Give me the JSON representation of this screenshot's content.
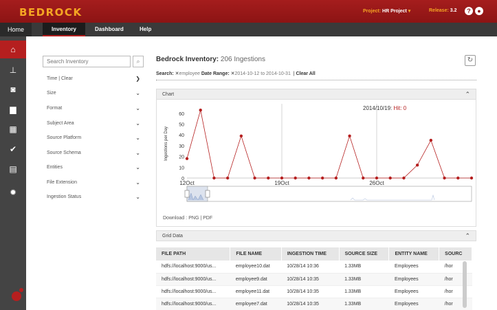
{
  "header": {
    "logo": "BEDROCK",
    "project_label": "Project:",
    "project_value": "HR Project",
    "release_label": "Release:",
    "release_value": "3.2",
    "help_icon": "?",
    "user_icon": "user-icon"
  },
  "nav": {
    "home": "Home",
    "tabs": [
      {
        "label": "Inventory"
      },
      {
        "label": "Dashboard"
      },
      {
        "label": "Help"
      }
    ]
  },
  "rail": {
    "icons": [
      "home-icon",
      "lineage-icon",
      "inventory-icon",
      "briefcase-icon",
      "grid-icon",
      "check-icon",
      "clipboard-icon",
      "settings-icon"
    ]
  },
  "filters": {
    "search_placeholder": "Search Inventory",
    "time_label": "Time | Clear",
    "facets": [
      {
        "label": "Size"
      },
      {
        "label": "Format"
      },
      {
        "label": "Subject Area"
      },
      {
        "label": "Source Platform"
      },
      {
        "label": "Source Schema"
      },
      {
        "label": "Entities"
      },
      {
        "label": "File Extension"
      },
      {
        "label": "Ingestion Status"
      }
    ]
  },
  "main": {
    "title": "Bedrock Inventory:",
    "count": "206 Ingestions",
    "search_label": "Search:",
    "search_term": "employee",
    "date_range_label": "Date Range:",
    "date_range_value": "2014-10-12 to 2014-10-31",
    "clear_all": "Clear All",
    "chart_panel": "Chart",
    "grid_panel": "Grid Data",
    "download_label": "Download :",
    "download_links": "PNG | PDF"
  },
  "chart_data": {
    "type": "line",
    "ylabel": "Ingestions per Day",
    "ylim": [
      0,
      65
    ],
    "yticks": [
      0,
      10,
      20,
      30,
      40,
      50,
      60
    ],
    "xtick_labels": [
      "12Oct",
      "19Oct",
      "26Oct"
    ],
    "tooltip": "2014/10/19:",
    "tooltip_hit": "Hit: 0",
    "series_color": "#b51f1f",
    "values": [
      18,
      63,
      0,
      0,
      39,
      0,
      0,
      0,
      0,
      0,
      0,
      0,
      39,
      0,
      0,
      0,
      0,
      12,
      35,
      0,
      0,
      0
    ]
  },
  "grid": {
    "columns": [
      "FILE PATH",
      "FILE NAME",
      "INGESTION TIME",
      "SOURCE SIZE",
      "ENTITY NAME",
      "SOURC"
    ],
    "rows": [
      [
        "hdfs://localhost:9000/us...",
        "employee10.dat",
        "10/28/14 10:36",
        "1.33MB",
        "Employees",
        "/hor"
      ],
      [
        "hdfs://localhost:9000/us...",
        "employee9.dat",
        "10/28/14 10:35",
        "1.33MB",
        "Employees",
        "/hor"
      ],
      [
        "hdfs://localhost:9000/us...",
        "employee11.dat",
        "10/28/14 10:35",
        "1.33MB",
        "Employees",
        "/hor"
      ],
      [
        "hdfs://localhost:9000/us...",
        "employee7.dat",
        "10/28/14 10:35",
        "1.33MB",
        "Employees",
        "/hor"
      ]
    ]
  }
}
